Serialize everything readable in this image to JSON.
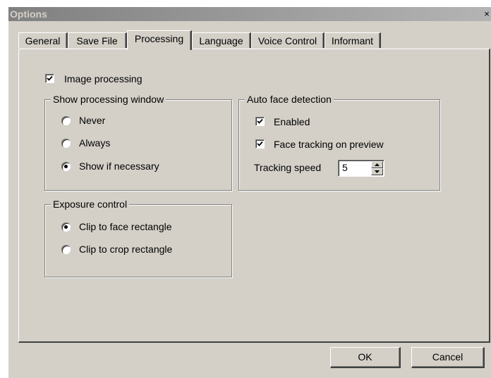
{
  "window": {
    "title": "Options",
    "close_glyph": "×"
  },
  "tabs": [
    {
      "label": "General",
      "active": false
    },
    {
      "label": "Save File",
      "active": false
    },
    {
      "label": "Processing",
      "active": true
    },
    {
      "label": "Language",
      "active": false
    },
    {
      "label": "Voice Control",
      "active": false
    },
    {
      "label": "Informant",
      "active": false
    }
  ],
  "processing": {
    "image_processing": {
      "label": "Image processing",
      "checked": true
    },
    "show_window": {
      "title": "Show processing window",
      "options": [
        {
          "label": "Never",
          "selected": false
        },
        {
          "label": "Always",
          "selected": false
        },
        {
          "label": "Show if necessary",
          "selected": true
        }
      ]
    },
    "auto_face": {
      "title": "Auto face detection",
      "enabled": {
        "label": "Enabled",
        "checked": true
      },
      "face_tracking": {
        "label": "Face tracking on preview",
        "checked": true
      },
      "tracking_speed": {
        "label": "Tracking speed",
        "value": "5"
      }
    },
    "exposure": {
      "title": "Exposure control",
      "options": [
        {
          "label": "Clip to face rectangle",
          "selected": true
        },
        {
          "label": "Clip to crop rectangle",
          "selected": false
        }
      ]
    }
  },
  "buttons": {
    "ok": "OK",
    "cancel": "Cancel"
  },
  "colors": {
    "face": "#d4d0c8",
    "shadow": "#808080",
    "dark_shadow": "#404040",
    "highlight": "#ffffff"
  }
}
